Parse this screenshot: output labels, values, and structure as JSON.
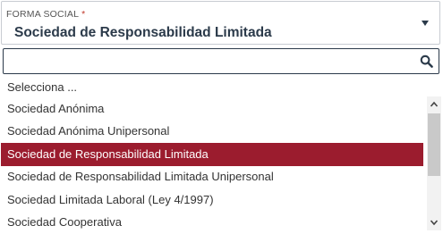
{
  "field": {
    "label": "FORMA SOCIAL",
    "required_mark": "*",
    "selected_value": "Sociedad de Responsabilidad Limitada"
  },
  "search": {
    "value": "",
    "icon": "search-icon"
  },
  "options": [
    "Selecciona ...",
    "Sociedad Anónima",
    "Sociedad Anónima Unipersonal",
    "Sociedad de Responsabilidad Limitada",
    "Sociedad de Responsabilidad Limitada Unipersonal",
    "Sociedad Limitada Laboral (Ley 4/1997)",
    "Sociedad Cooperativa"
  ],
  "highlighted_option": "Sociedad de Responsabilidad Limitada",
  "colors": {
    "highlight": "#9b1c2e",
    "required": "#c0392b",
    "text_dark": "#2b3a4a"
  }
}
